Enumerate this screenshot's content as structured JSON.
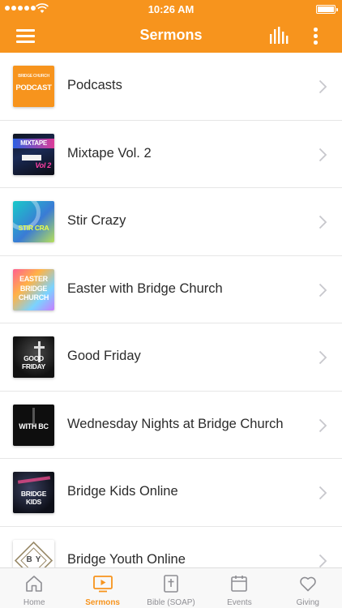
{
  "status_bar": {
    "time": "10:26 AM"
  },
  "header": {
    "title": "Sermons",
    "accent_color": "#f7941d",
    "menu_icon": "hamburger-icon",
    "audio_icon": "audio-bars-icon",
    "more_icon": "more-vertical-icon"
  },
  "sermons": [
    {
      "label": "Podcasts",
      "thumb_text": "PODCAST",
      "thumb_subtext": "BRIDGE CHURCH"
    },
    {
      "label": "Mixtape Vol. 2",
      "thumb_text": "MIXTAPE",
      "thumb_subtext": "Vol 2"
    },
    {
      "label": "Stir Crazy",
      "thumb_text": "STIR CRA"
    },
    {
      "label": "Easter with Bridge Church",
      "thumb_text": "EASTER",
      "thumb_subtext": "BRIDGE CHURCH"
    },
    {
      "label": "Good Friday",
      "thumb_text": "GOOD FRIDAY"
    },
    {
      "label": "Wednesday Nights at Bridge Church",
      "thumb_text": "WITH BC"
    },
    {
      "label": "Bridge Kids Online",
      "thumb_text": "BRIDGE KIDS"
    },
    {
      "label": "Bridge Youth Online",
      "thumb_text": "BY"
    }
  ],
  "tabs": [
    {
      "label": "Home",
      "icon": "home-icon",
      "active": false
    },
    {
      "label": "Sermons",
      "icon": "video-icon",
      "active": true
    },
    {
      "label": "Bible (SOAP)",
      "icon": "bible-icon",
      "active": false
    },
    {
      "label": "Events",
      "icon": "calendar-icon",
      "active": false
    },
    {
      "label": "Giving",
      "icon": "heart-icon",
      "active": false
    }
  ]
}
